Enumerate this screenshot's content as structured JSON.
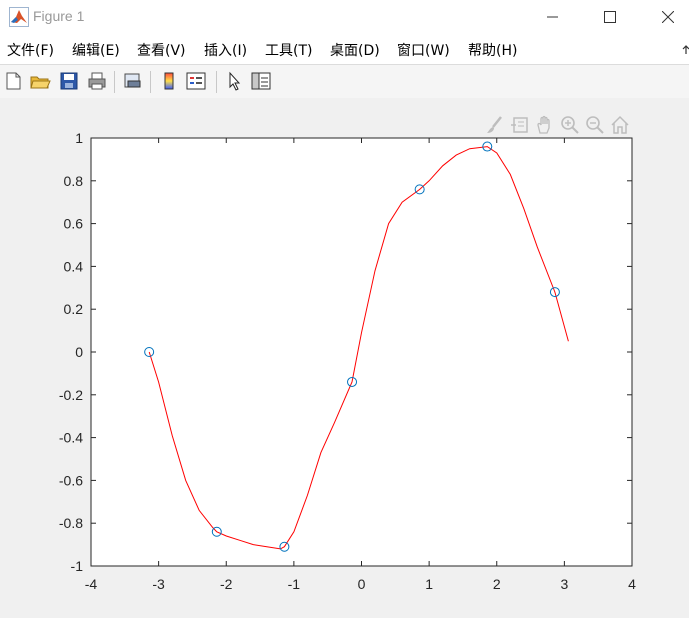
{
  "window": {
    "title": "Figure 1"
  },
  "menu": {
    "items": [
      "文件(F)",
      "编辑(E)",
      "查看(V)",
      "插入(I)",
      "工具(T)",
      "桌面(D)",
      "窗口(W)",
      "帮助(H)"
    ]
  },
  "toolbar": {
    "icons": [
      "new-figure-icon",
      "open-file-icon",
      "save-icon",
      "print-icon",
      "link-plot-icon",
      "insert-colorbar-icon",
      "insert-legend-icon",
      "edit-plot-icon",
      "property-inspector-icon"
    ]
  },
  "axes_toolbar": {
    "icons": [
      "brush-icon",
      "data-tips-icon",
      "pan-icon",
      "zoom-in-icon",
      "zoom-out-icon",
      "home-icon"
    ]
  },
  "colors": {
    "curve": "#ff0000",
    "markers": "#0072bd",
    "axes_bg": "#ffffff",
    "figure_bg": "#f0f0f0"
  },
  "chart_data": {
    "type": "line",
    "xlim": [
      -4,
      4
    ],
    "ylim": [
      -1,
      1
    ],
    "xticks": [
      "-4",
      "-3",
      "-2",
      "-1",
      "0",
      "1",
      "2",
      "3",
      "4"
    ],
    "yticks": [
      "1",
      "0.8",
      "0.6",
      "0.4",
      "0.2",
      "0",
      "-0.2",
      "-0.4",
      "-0.6",
      "-0.8",
      "-1"
    ],
    "grid": false,
    "series": [
      {
        "style": "markers",
        "marker": "circle",
        "x": [
          -3.14,
          -2.14,
          -1.14,
          -0.14,
          0.86,
          1.86,
          2.86
        ],
        "y": [
          0.0,
          -0.84,
          -0.91,
          -0.14,
          0.76,
          0.96,
          0.28
        ]
      },
      {
        "style": "line",
        "x": [
          -3.14,
          -3.0,
          -2.8,
          -2.6,
          -2.4,
          -2.2,
          -2.14,
          -2.0,
          -1.8,
          -1.6,
          -1.4,
          -1.2,
          -1.14,
          -1.0,
          -0.8,
          -0.6,
          -0.4,
          -0.14,
          0.0,
          0.2,
          0.4,
          0.6,
          0.86,
          1.0,
          1.2,
          1.4,
          1.6,
          1.86,
          2.0,
          2.2,
          2.4,
          2.6,
          2.86,
          3.06
        ],
        "y": [
          0.0,
          -0.14,
          -0.39,
          -0.6,
          -0.74,
          -0.82,
          -0.84,
          -0.86,
          -0.88,
          -0.9,
          -0.91,
          -0.92,
          -0.91,
          -0.84,
          -0.67,
          -0.47,
          -0.33,
          -0.14,
          0.09,
          0.38,
          0.6,
          0.7,
          0.76,
          0.8,
          0.87,
          0.92,
          0.95,
          0.96,
          0.93,
          0.83,
          0.67,
          0.49,
          0.28,
          0.05
        ]
      }
    ]
  }
}
